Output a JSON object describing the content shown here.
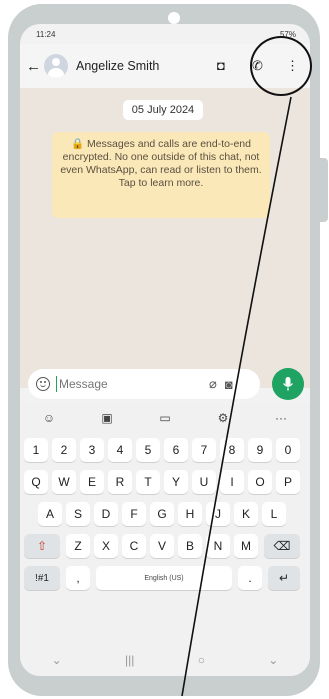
{
  "status_bar": {
    "time": "11:24",
    "battery": "57%"
  },
  "header": {
    "back_icon": "arrow-left-icon",
    "contact_name": "Angelize Smith",
    "icons": [
      "video-call-icon",
      "phone-call-icon",
      "more-vert-icon"
    ]
  },
  "chat": {
    "date": "05 July 2024",
    "encryption_notice": "🔒 Messages and calls are end-to-end encrypted. No one outside of this chat, not even WhatsApp, can read or listen to them. Tap to learn more."
  },
  "composer": {
    "placeholder": "Message",
    "icons": [
      "emoji-icon",
      "attach-icon",
      "camera-icon",
      "mic-icon"
    ]
  },
  "keyboard": {
    "toolbar": [
      "☺",
      "▣",
      "▭",
      "⚙",
      "···"
    ],
    "row_numbers": [
      "1",
      "2",
      "3",
      "4",
      "5",
      "6",
      "7",
      "8",
      "9",
      "0"
    ],
    "row1": [
      "Q",
      "W",
      "E",
      "R",
      "T",
      "Y",
      "U",
      "I",
      "O",
      "P"
    ],
    "row2": [
      "A",
      "S",
      "D",
      "F",
      "G",
      "H",
      "J",
      "K",
      "L"
    ],
    "row3": [
      "Z",
      "X",
      "C",
      "V",
      "B",
      "N",
      "M"
    ],
    "shift": "⇧",
    "backspace": "⌫",
    "symbols": "!#1",
    "comma": ",",
    "space_label": "English (US)",
    "period": ".",
    "enter": "↵"
  },
  "nav": [
    "⌄",
    "|||",
    "○",
    "⌄"
  ],
  "colors": {
    "accent": "#1ea362",
    "chat_bg": "#ece5dd",
    "notice_bg": "#fbe8b8"
  }
}
